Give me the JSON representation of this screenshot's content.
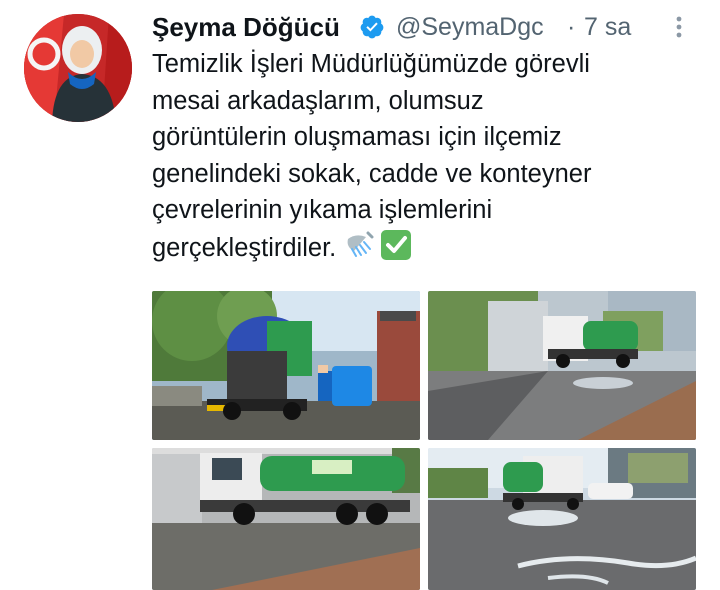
{
  "user": {
    "display_name": "Şeyma Döğücü",
    "handle": "@SeymaDgc",
    "separator": "·",
    "time": "7 sa",
    "verified_icon": "verified-badge-icon"
  },
  "tweet": {
    "lines": [
      "Temizlik İşleri Müdürlüğümüzde görevli",
      "mesai arkadaşlarım, olumsuz",
      "görüntülerin oluşmaması için ilçemiz",
      "genelindeki sokak, cadde ve konteyner",
      "çevrelerinin yıkama işlemlerini",
      "gerçekleştirdiler."
    ],
    "emojis": [
      "shower-icon",
      "check-mark-button-icon"
    ]
  },
  "colors": {
    "text": "#0f1419",
    "secondary": "#536471",
    "verified": "#1d9bf0",
    "check_emoji": "#4caf50"
  }
}
